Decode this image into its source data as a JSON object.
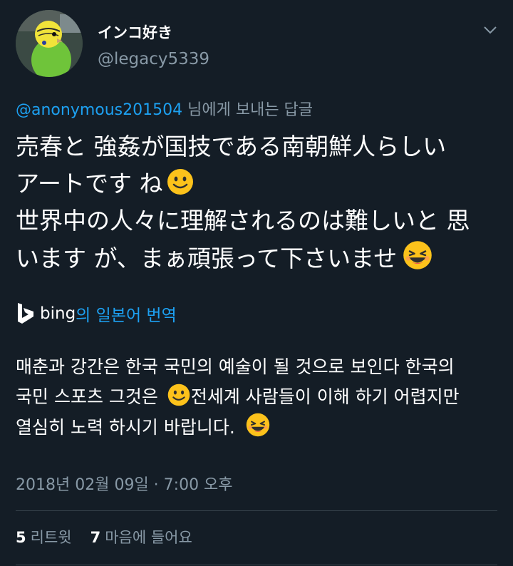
{
  "user": {
    "display_name": "インコ好き",
    "handle": "@legacy5339"
  },
  "reply": {
    "mention": "@anonymous201504",
    "suffix": " 님에게 보내는 답글"
  },
  "tweet": {
    "lines": [
      "売春と 強姦が国技である南朝鮮人らしい",
      "アートです ね",
      "世界中の人々に理解されるのは難しいと 思",
      "います が、まぁ頑張って下さいませ"
    ]
  },
  "translation": {
    "brand": "bing",
    "label": "의 일본어 번역",
    "lines": [
      "매춘과 강간은 한국 국민의 예술이 될 것으로 보인다 한국의",
      "국민 스포츠  그것은",
      "전세계 사람들이 이해 하기 어렵지만",
      "열심히 노력 하시기 바랍니다."
    ]
  },
  "timestamp": "2018년 02월 09일 · 7:00 오후",
  "stats": {
    "retweets_count": "5",
    "retweets_label": "리트윗",
    "likes_count": "7",
    "likes_label": "마음에 들어요"
  },
  "colors": {
    "background": "#141d26",
    "accent": "#1da1f2",
    "secondary_text": "#8899a6",
    "divider": "#38444d"
  },
  "icons": {
    "menu": "chevron-down-icon",
    "smile_emoji": "slightly-smiling-face-icon",
    "grin_emoji": "grinning-squinting-face-icon",
    "translate_brand": "bing-logo-icon"
  }
}
